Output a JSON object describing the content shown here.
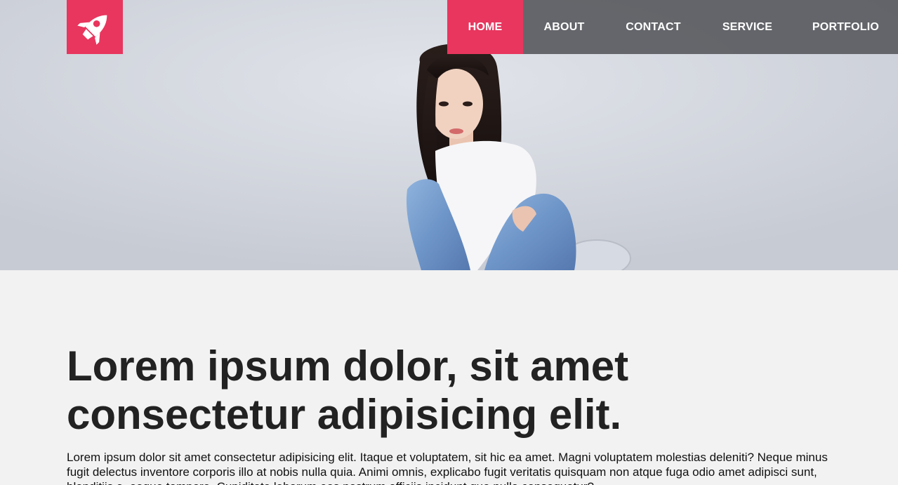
{
  "brand": {
    "logo_icon": "rocket-icon",
    "accent_color": "#e8365e"
  },
  "nav": {
    "items": [
      {
        "label": "HOME",
        "active": true
      },
      {
        "label": "ABOUT",
        "active": false
      },
      {
        "label": "CONTACT",
        "active": false
      },
      {
        "label": "SERVICE",
        "active": false
      },
      {
        "label": "PORTFOLIO",
        "active": false
      }
    ],
    "background_color": "#5a5b60"
  },
  "hero": {
    "image": "portrait-photo"
  },
  "main": {
    "headline": "Lorem ipsum dolor, sit amet consectetur adipisicing elit.",
    "paragraph": "Lorem ipsum dolor sit amet consectetur adipisicing elit. Itaque et voluptatem, sit hic ea amet. Magni voluptatem molestias deleniti? Neque minus fugit delectus inventore corporis illo at nobis nulla quia. Animi omnis, explicabo fugit veritatis quisquam non atque fuga odio amet adipisci sunt, blanditiis a, eaque tempore. Cupiditate laborum eos nostrum officiis incidunt quo nulla consequatur?"
  }
}
